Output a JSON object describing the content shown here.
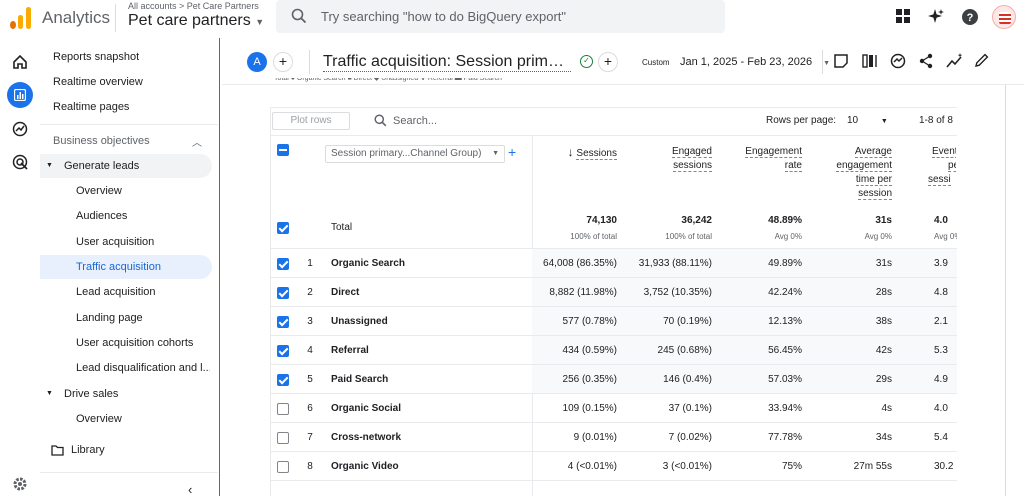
{
  "topbar": {
    "app_name": "Analytics",
    "account_crumb": "All accounts > Pet Care Partners",
    "account_name": "Pet care partners",
    "search_placeholder": "Try searching \"how to do BigQuery export\""
  },
  "sidebar": {
    "items": [
      {
        "label": "Reports snapshot"
      },
      {
        "label": "Realtime overview"
      },
      {
        "label": "Realtime pages"
      }
    ],
    "section_label": "Business objectives",
    "group_generate": "Generate leads",
    "generate_items": [
      {
        "label": "Overview"
      },
      {
        "label": "Audiences"
      },
      {
        "label": "User acquisition"
      },
      {
        "label": "Traffic acquisition"
      },
      {
        "label": "Lead acquisition"
      },
      {
        "label": "Landing page"
      },
      {
        "label": "User acquisition cohorts"
      },
      {
        "label": "Lead disqualification and l..."
      }
    ],
    "group_drive": "Drive sales",
    "drive_items": [
      {
        "label": "Overview"
      }
    ],
    "library": "Library"
  },
  "report": {
    "avatar": "A",
    "title": "Traffic acquisition: Session primary Channel Group (Default Channel Group)",
    "custom_chip": "Custom",
    "date_range": "Jan 1, 2025 - Feb 23, 2026",
    "legend_partial": "Total  ● Organic Search  ■ Direct  ◆ Unassigned  ✚ Referral  ▬ Paid Search"
  },
  "table": {
    "plot_rows": "Plot rows",
    "search_placeholder": "Search...",
    "rows_per_page_label": "Rows per page:",
    "rows_per_page_value": "10",
    "range": "1-8 of 8",
    "dimension": "Session primary...Channel Group)",
    "columns": [
      {
        "l1": "Sessions",
        "l2": ""
      },
      {
        "l1": "Engaged",
        "l2": "sessions"
      },
      {
        "l1": "Engagement",
        "l2": "rate"
      },
      {
        "l1": "Average",
        "l2": "engagement",
        "l3": "time per",
        "l4": "session"
      },
      {
        "l1": "Event",
        "l2": "per",
        "l3": "sessi"
      }
    ],
    "total": {
      "label": "Total",
      "values": [
        "74,130",
        "36,242",
        "48.89%",
        "31s",
        "4.0"
      ],
      "subs": [
        "100% of total",
        "100% of total",
        "Avg 0%",
        "Avg 0%",
        "Avg 0%"
      ]
    },
    "rows": [
      {
        "num": "1",
        "name": "Organic Search",
        "checked": true,
        "v": [
          "64,008 (86.35%)",
          "31,933 (88.11%)",
          "49.89%",
          "31s",
          "3.9"
        ]
      },
      {
        "num": "2",
        "name": "Direct",
        "checked": true,
        "v": [
          "8,882 (11.98%)",
          "3,752 (10.35%)",
          "42.24%",
          "28s",
          "4.8"
        ]
      },
      {
        "num": "3",
        "name": "Unassigned",
        "checked": true,
        "v": [
          "577 (0.78%)",
          "70 (0.19%)",
          "12.13%",
          "38s",
          "2.1"
        ]
      },
      {
        "num": "4",
        "name": "Referral",
        "checked": true,
        "v": [
          "434 (0.59%)",
          "245 (0.68%)",
          "56.45%",
          "42s",
          "5.3"
        ]
      },
      {
        "num": "5",
        "name": "Paid Search",
        "checked": true,
        "v": [
          "256 (0.35%)",
          "146 (0.4%)",
          "57.03%",
          "29s",
          "4.9"
        ]
      },
      {
        "num": "6",
        "name": "Organic Social",
        "checked": false,
        "v": [
          "109 (0.15%)",
          "37 (0.1%)",
          "33.94%",
          "4s",
          "4.0"
        ]
      },
      {
        "num": "7",
        "name": "Cross-network",
        "checked": false,
        "v": [
          "9 (0.01%)",
          "7 (0.02%)",
          "77.78%",
          "34s",
          "5.4"
        ]
      },
      {
        "num": "8",
        "name": "Organic Video",
        "checked": false,
        "v": [
          "4 (<0.01%)",
          "3 (<0.01%)",
          "75%",
          "27m 55s",
          "30.2"
        ]
      }
    ]
  },
  "colors": {
    "accent": "#1a73e8",
    "logo_orange": "#f9ab00",
    "logo_dark": "#e37400"
  }
}
